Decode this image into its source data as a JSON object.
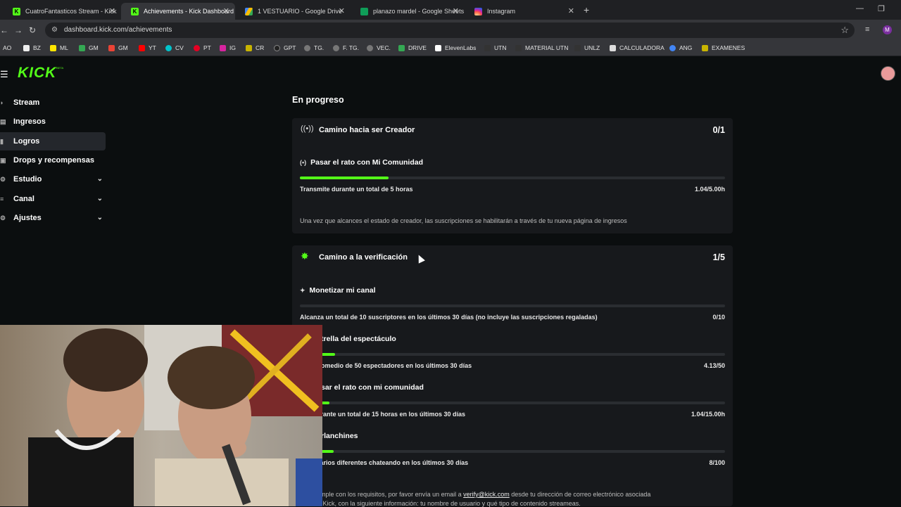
{
  "browser": {
    "tabs": [
      {
        "title": "CuatroFantasticos Stream - Kick",
        "icon_color": "#53fc18",
        "icon": "K"
      },
      {
        "title": "Achievements - Kick Dashboard",
        "icon_color": "#53fc18",
        "icon": "K"
      },
      {
        "title": "1 VESTUARIO - Google Drive",
        "icon_color": "#4285f4",
        "icon": "drive-icon"
      },
      {
        "title": "planazo mardel - Google Sheets",
        "icon_color": "#0f9d58",
        "icon": "sheets-icon"
      },
      {
        "title": "Instagram",
        "icon_color": "#e1306c",
        "icon": "instagram-icon"
      }
    ],
    "url": "dashboard.kick.com/achievements",
    "profile_letter": "M",
    "bookmarks": [
      "AO",
      "BZ",
      "ML",
      "GM",
      "GM",
      "YT",
      "CV",
      "PT",
      "IG",
      "CR",
      "GPT",
      "TG.",
      "F. TG.",
      "VEC.",
      "DRIVE",
      "ElevenLabs",
      "UTN",
      "MATERIAL UTN",
      "UNLZ",
      "CALCULADORA",
      "ANG",
      "EXAMENES"
    ]
  },
  "brand": {
    "name": "KICK",
    "tag": "BETA",
    "accent": "#53fc18"
  },
  "sidebar": {
    "items": [
      {
        "label": "Stream",
        "expandable": false
      },
      {
        "label": "Ingresos",
        "expandable": false
      },
      {
        "label": "Logros",
        "expandable": false,
        "selected": true
      },
      {
        "label": "Drops y recompensas",
        "expandable": false
      },
      {
        "label": "Estudio",
        "expandable": true
      },
      {
        "label": "Canal",
        "expandable": true
      },
      {
        "label": "Ajustes",
        "expandable": true
      }
    ]
  },
  "main": {
    "section_title": "En progreso",
    "creator": {
      "title": "Camino hacia ser Creador",
      "count": "0/1",
      "goal_title": "Pasar el rato con Mi Comunidad",
      "requirement": "Transmite durante un total de 5 horas",
      "value": "1.04/5.00h",
      "progress": 0.208,
      "note": "Una vez que alcances el estado de creador, las suscripciones se habilitarán a través de tu nueva página de ingresos"
    },
    "verification": {
      "title": "Camino a la verificación",
      "count": "1/5",
      "goals": [
        {
          "title": "Monetizar mi canal",
          "requirement": "Alcanza un total de 10 suscriptores en los últimos 30 días (no incluye las suscripciones regaladas)",
          "value": "0/10",
          "progress": 0.0
        },
        {
          "title": "trella del espectáculo",
          "requirement": "a un promedio de 50 espectadores en los últimos 30 días",
          "value": "4.13/50",
          "progress": 0.083
        },
        {
          "title": "sar el rato con mi comunidad",
          "requirement": "nite durante un total de 15 horas en los últimos 30 días",
          "value": "1.04/15.00h",
          "progress": 0.069
        },
        {
          "title": "rlanchines",
          "requirement": "00 usuarios diferentes chateando en los últimos 30 días",
          "value": "8/100",
          "progress": 0.08
        }
      ],
      "footer_before": "anal cumple con los requisitos, por favor envía un email a ",
      "footer_link": "verify@kick.com",
      "footer_after": " desde tu dirección de correo electrónico asociada",
      "footer_line2": "enta de Kick, con la siguiente información: tu nombre de usuario y qué tipo de contenido streameas."
    }
  }
}
